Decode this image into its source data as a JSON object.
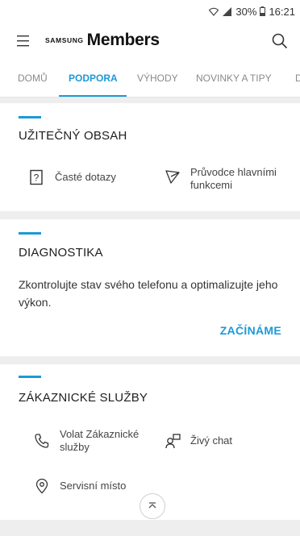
{
  "status": {
    "battery": "30%",
    "time": "16:21"
  },
  "app": {
    "brand_small": "SAMSUNG",
    "brand_large": "Members"
  },
  "tabs": [
    {
      "label": "DOMŮ"
    },
    {
      "label": "PODPORA"
    },
    {
      "label": "VÝHODY"
    },
    {
      "label": "NOVINKY A TIPY"
    },
    {
      "label": "D"
    }
  ],
  "useful": {
    "title": "UŽITEČNÝ OBSAH",
    "faq": "Časté dotazy",
    "guide_line1": "Průvodce hlavními",
    "guide_line2": "funkcemi"
  },
  "diagnostics": {
    "title": "DIAGNOSTIKA",
    "text": "Zkontrolujte stav svého telefonu a optimalizujte jeho výkon.",
    "action": "ZAČÍNÁME"
  },
  "customer": {
    "title": "ZÁKAZNICKÉ SLUŽBY",
    "call_line1": "Volat Zákaznické",
    "call_line2": "služby",
    "chat": "Živý chat",
    "service": "Servisní místo"
  },
  "colors": {
    "accent": "#1b9ad6",
    "background": "#eeeeee"
  }
}
